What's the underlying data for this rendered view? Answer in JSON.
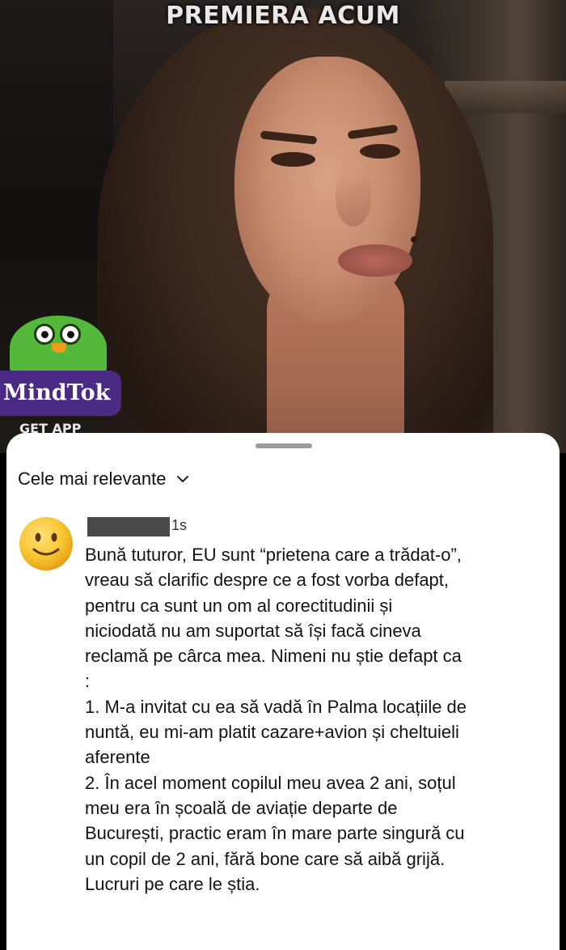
{
  "video": {
    "banner": "PREMIERA ACUM",
    "brand": {
      "name": "MindTok",
      "cta": "GET APP",
      "color": "#4b2a85"
    }
  },
  "comments": {
    "sort_label": "Cele mai relevante",
    "sort_icon": "chevron-down-icon",
    "items": [
      {
        "avatar_icon": "slightly-smiling-face-emoji",
        "username_redacted": true,
        "timestamp": "1s",
        "lines": [
          "Bună tuturor, EU sunt “prietena care a trădat-o”,",
          "vreau să clarific despre ce a fost vorba defapt,",
          "pentru ca sunt un om al corectitudinii și",
          "niciodată nu am suportat să își facă cineva",
          "reclamă pe cârca mea.  Nimeni nu știe defapt ca",
          ":",
          "1. M-a invitat cu ea să vadă în Palma locațiile de",
          "nuntă, eu mi-am platit cazare+avion și cheltuieli",
          "aferente",
          "2. În acel moment copilul meu avea 2 ani, soțul",
          "meu era în școală de aviație departe de",
          "București, practic eram în mare parte singură cu",
          "un copil de 2 ani, fără bone care să aibă grijă.",
          "Lucruri pe care le știa."
        ]
      }
    ]
  }
}
